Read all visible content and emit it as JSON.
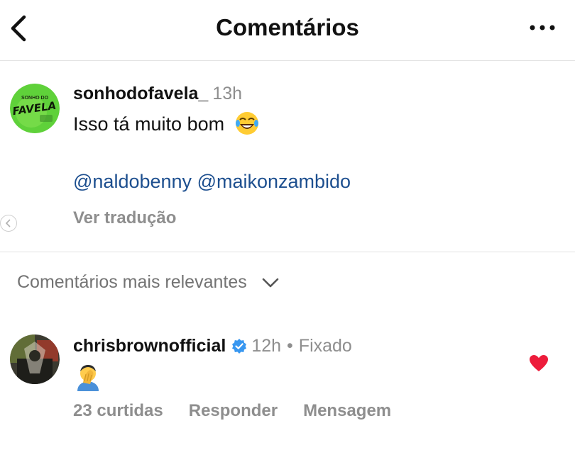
{
  "header": {
    "title": "Comentários",
    "back_icon": "chevron-left-icon",
    "more_icon": "more-horizontal-icon"
  },
  "caption": {
    "username": "sonhodofavela_",
    "time": "13h",
    "text": "Isso tá muito bom",
    "emoji": "😂",
    "mentions": [
      "@naldobenny",
      "@maikonzambido"
    ],
    "translate_label": "Ver tradução",
    "avatar_text": [
      "SONHO DO",
      "FAVELA"
    ]
  },
  "sort": {
    "label": "Comentários mais relevantes",
    "icon": "chevron-down-icon"
  },
  "comments": [
    {
      "username": "chrisbrownofficial",
      "verified": true,
      "time": "12h",
      "pinned_label": "Fixado",
      "text": "🤦‍♂️",
      "likes_label": "23 curtidas",
      "reply_label": "Responder",
      "message_label": "Mensagem",
      "liked": true,
      "heart_color": "#ed1c3b"
    }
  ],
  "colors": {
    "mention": "#1d4f8f",
    "secondary_text": "#8e8e8e",
    "verified_badge": "#3897f0",
    "avatar_green": "#5fd13a"
  }
}
